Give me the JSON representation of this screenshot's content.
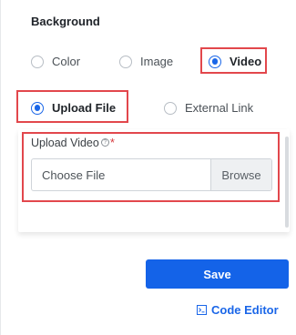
{
  "section": {
    "title": "Background"
  },
  "background_type": {
    "options": [
      {
        "label": "Color",
        "checked": false
      },
      {
        "label": "Image",
        "checked": false
      },
      {
        "label": "Video",
        "checked": true
      }
    ]
  },
  "video_source": {
    "options": [
      {
        "label": "Upload File",
        "checked": true
      },
      {
        "label": "External Link",
        "checked": false
      }
    ]
  },
  "upload": {
    "label": "Upload Video",
    "help_icon": "?",
    "required_mark": "*",
    "placeholder": "Choose File",
    "browse_label": "Browse"
  },
  "actions": {
    "save_label": "Save",
    "code_editor_label": "Code Editor"
  },
  "colors": {
    "accent": "#1a66e8",
    "primary_button": "#1463e8",
    "highlight": "#e2474c",
    "required": "#d63a3f"
  },
  "icons": {
    "code_editor": "terminal-icon"
  }
}
